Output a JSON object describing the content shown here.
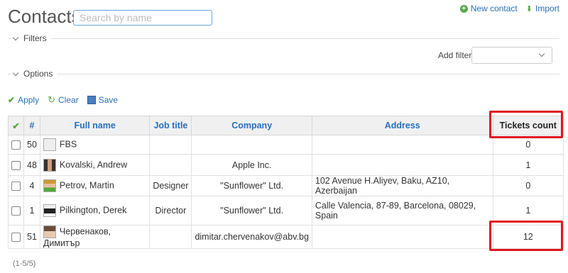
{
  "header": {
    "title": "Contacts",
    "search_placeholder": "Search by name",
    "new_contact": "New contact",
    "import": "Import"
  },
  "filters": {
    "label": "Filters",
    "add_filter_label": "Add filter",
    "add_filter_value": ""
  },
  "options": {
    "label": "Options"
  },
  "actions": {
    "apply": "Apply",
    "clear": "Clear",
    "save": "Save"
  },
  "table": {
    "columns": {
      "num": "#",
      "full_name": "Full name",
      "job_title": "Job title",
      "company": "Company",
      "address": "Address",
      "tickets_count": "Tickets count"
    },
    "rows": [
      {
        "num": "50",
        "name": "FBS",
        "job": "",
        "company": "",
        "address": "",
        "tickets": "0",
        "avatar": "blank"
      },
      {
        "num": "48",
        "name": "Kovalski, Andrew",
        "job": "",
        "company": "Apple Inc.",
        "address": "",
        "tickets": "1",
        "avatar": "photo"
      },
      {
        "num": "4",
        "name": "Petrov, Martin",
        "job": "Designer",
        "company": "\"Sunflower\" Ltd.",
        "address": "102 Avenue H.Aliyev, Baku, AZ10, Azerbaijan",
        "tickets": "0",
        "avatar": "photo"
      },
      {
        "num": "1",
        "name": "Pilkington, Derek",
        "job": "Director",
        "company": "\"Sunflower\" Ltd.",
        "address": "Calle Valencia, 87-89, Barcelona, 08029, Spain",
        "tickets": "1",
        "avatar": "photo"
      },
      {
        "num": "51",
        "name": "Червенаков, Димитър",
        "job": "",
        "company": "dimitar.chervenakov@abv.bg",
        "address": "",
        "tickets": "12",
        "avatar": "photo"
      }
    ]
  },
  "pager": {
    "text": "(1-5/5)"
  },
  "colors": {
    "link": "#2a6fbb",
    "highlight": "#e0161f",
    "accent_green": "#5aa845"
  }
}
